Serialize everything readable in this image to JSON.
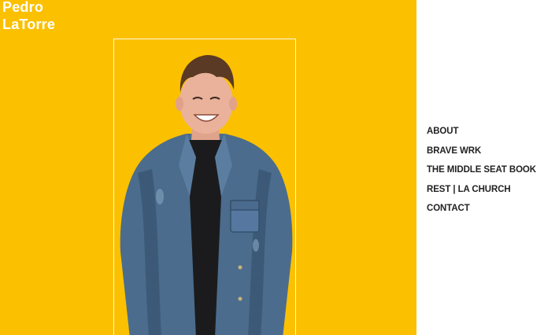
{
  "site": {
    "title": "Pedro\nLaTorre",
    "brand_color": "#fbc000",
    "text_color_on_brand": "#ffffff"
  },
  "hero": {
    "photo_description_icon": "person-portrait"
  },
  "nav": {
    "items": [
      {
        "label": "ABOUT"
      },
      {
        "label": "BRAVE WRK"
      },
      {
        "label": "THE MIDDLE SEAT BOOK"
      },
      {
        "label": "REST | LA CHURCH"
      },
      {
        "label": "CONTACT"
      }
    ],
    "text_color": "#222222"
  }
}
